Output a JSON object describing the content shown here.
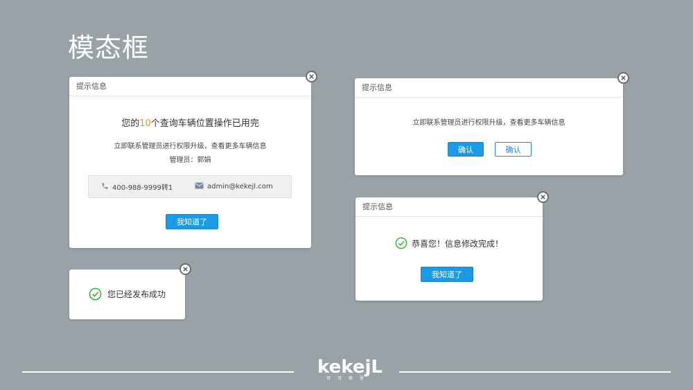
{
  "page": {
    "title": "模态框"
  },
  "modal1": {
    "header": "提示信息",
    "line_prefix": "您的",
    "count": "10",
    "line_suffix": "个查询车辆位置操作已用完",
    "sub1": "立即联系管理员进行权限升级，查看更多车辆信息",
    "sub2": "管理员：郭娟",
    "phone": "400-988-9999转1",
    "email": "admin@kekejl.com",
    "button": "我知道了",
    "accent_color": "#f08c1e"
  },
  "modal2": {
    "header": "提示信息",
    "text": "立即联系管理员进行权限升级，查看更多车辆信息",
    "confirm_primary": "确认",
    "confirm_outline": "确认"
  },
  "modal3": {
    "header": "提示信息",
    "text": "恭喜您！信息修改完成！",
    "button": "我知道了"
  },
  "toast": {
    "text": "您已经发布成功"
  },
  "footer": {
    "logo": "kekejL",
    "logo_sub": "可 可 家 里"
  },
  "colors": {
    "background": "#98a2a7",
    "primary": "#1a9be6",
    "success": "#2eb135"
  }
}
